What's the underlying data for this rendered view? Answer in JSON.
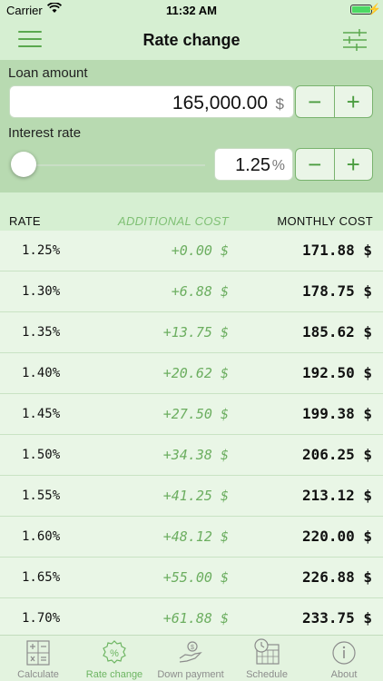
{
  "status": {
    "carrier": "Carrier",
    "time": "11:32 AM"
  },
  "nav": {
    "title": "Rate change"
  },
  "loan": {
    "label": "Loan amount",
    "value": "165,000.00",
    "unit": "$",
    "minus": "−",
    "plus": "+"
  },
  "interest": {
    "label": "Interest rate",
    "value": "1.25",
    "unit": "%",
    "minus": "−",
    "plus": "+"
  },
  "table": {
    "headers": {
      "rate": "RATE",
      "additional": "ADDITIONAL COST",
      "monthly": "MONTHLY COST"
    },
    "rows": [
      {
        "rate": "1.25%",
        "add": "+0.00 $",
        "monthly": "171.88 $"
      },
      {
        "rate": "1.30%",
        "add": "+6.88 $",
        "monthly": "178.75 $"
      },
      {
        "rate": "1.35%",
        "add": "+13.75 $",
        "monthly": "185.62 $"
      },
      {
        "rate": "1.40%",
        "add": "+20.62 $",
        "monthly": "192.50 $"
      },
      {
        "rate": "1.45%",
        "add": "+27.50 $",
        "monthly": "199.38 $"
      },
      {
        "rate": "1.50%",
        "add": "+34.38 $",
        "monthly": "206.25 $"
      },
      {
        "rate": "1.55%",
        "add": "+41.25 $",
        "monthly": "213.12 $"
      },
      {
        "rate": "1.60%",
        "add": "+48.12 $",
        "monthly": "220.00 $"
      },
      {
        "rate": "1.65%",
        "add": "+55.00 $",
        "monthly": "226.88 $"
      },
      {
        "rate": "1.70%",
        "add": "+61.88 $",
        "monthly": "233.75 $"
      }
    ]
  },
  "tabs": {
    "calculate": "Calculate",
    "rate_change": "Rate change",
    "down_payment": "Down payment",
    "schedule": "Schedule",
    "about": "About"
  },
  "icons": {
    "menu": "hamburger-menu-icon",
    "settings": "sliders-icon",
    "collapse": "chevron-up-double-icon",
    "calculate": "calculator-icon",
    "rate_change": "percent-badge-icon",
    "down_payment": "hand-coin-icon",
    "schedule": "calendar-clock-icon",
    "about": "info-circle-icon"
  },
  "colors": {
    "accent": "#5aa84e",
    "active_tab": "#6db562",
    "inactive_tab": "#8c8c8c"
  }
}
